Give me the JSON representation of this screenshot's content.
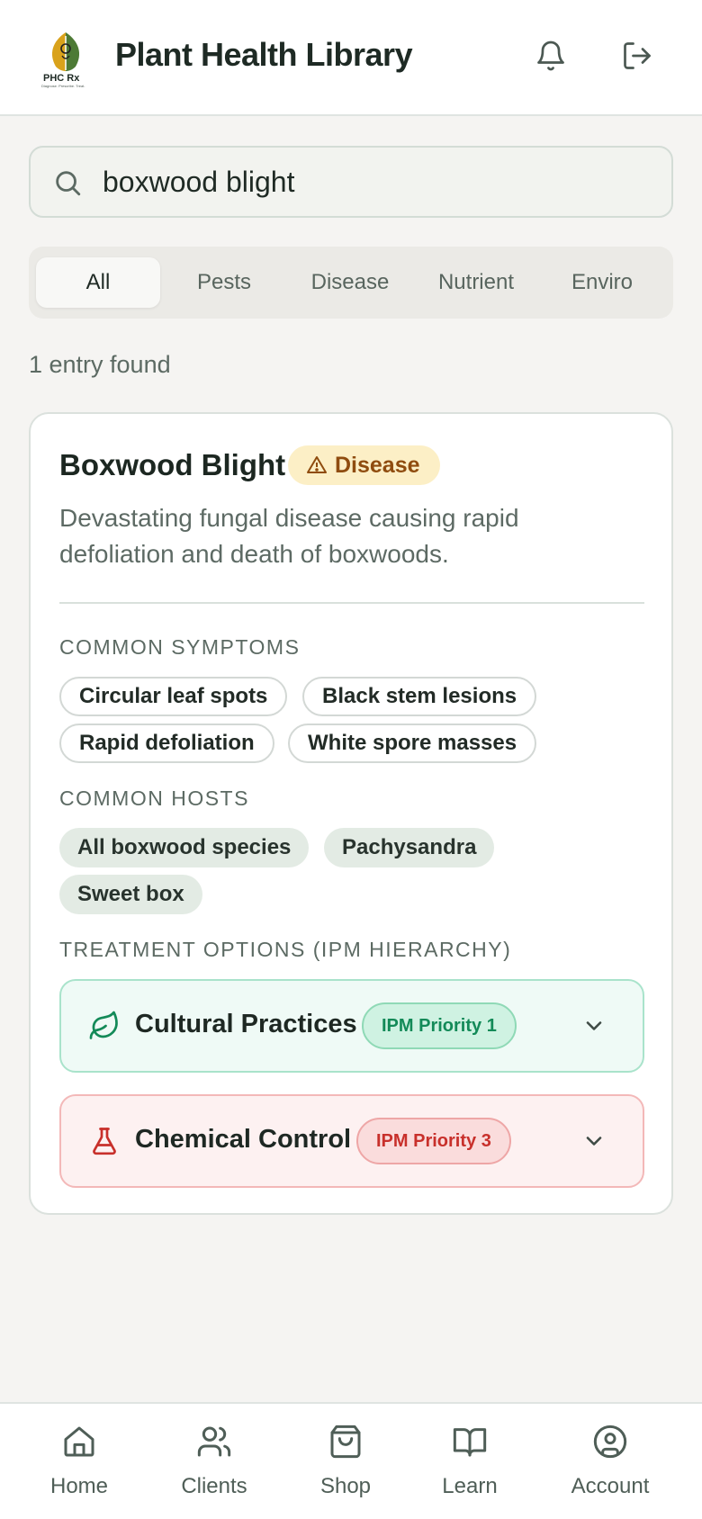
{
  "header": {
    "title": "Plant Health Library",
    "logo_text": "PHC Rx",
    "logo_tagline": "Diagnose. Prescribe. Treat."
  },
  "search": {
    "value": "boxwood blight",
    "placeholder": ""
  },
  "tabs": [
    {
      "label": "All",
      "active": true
    },
    {
      "label": "Pests",
      "active": false
    },
    {
      "label": "Disease",
      "active": false
    },
    {
      "label": "Nutrient",
      "active": false
    },
    {
      "label": "Enviro",
      "active": false
    }
  ],
  "results_count": "1 entry found",
  "entry": {
    "title": "Boxwood Blight",
    "category_badge": "Disease",
    "description": "Devastating fungal disease causing rapid defoliation and death of boxwoods.",
    "symptoms_label": "COMMON SYMPTOMS",
    "symptoms": [
      "Circular leaf spots",
      "Black stem lesions",
      "Rapid defoliation",
      "White spore masses"
    ],
    "hosts_label": "COMMON HOSTS",
    "hosts": [
      "All boxwood species",
      "Pachysandra",
      "Sweet box"
    ],
    "treatments_label": "TREATMENT OPTIONS (IPM HIERARCHY)",
    "treatments": [
      {
        "label": "Cultural Practices",
        "priority": "IPM Priority 1",
        "icon": "leaf-icon",
        "color": "#138a58"
      },
      {
        "label": "Chemical Control",
        "priority": "IPM Priority 3",
        "icon": "flask-icon",
        "color": "#c8302b"
      }
    ]
  },
  "bottom_nav": [
    {
      "label": "Home",
      "icon": "home-icon"
    },
    {
      "label": "Clients",
      "icon": "users-icon"
    },
    {
      "label": "Shop",
      "icon": "shopping-bag-icon"
    },
    {
      "label": "Learn",
      "icon": "book-icon"
    },
    {
      "label": "Account",
      "icon": "user-circle-icon"
    }
  ],
  "colors": {
    "disease_badge_bg": "#fcefc6",
    "disease_badge_text": "#8f4c0f",
    "priority1": "#138a58",
    "priority3": "#c8302b"
  }
}
